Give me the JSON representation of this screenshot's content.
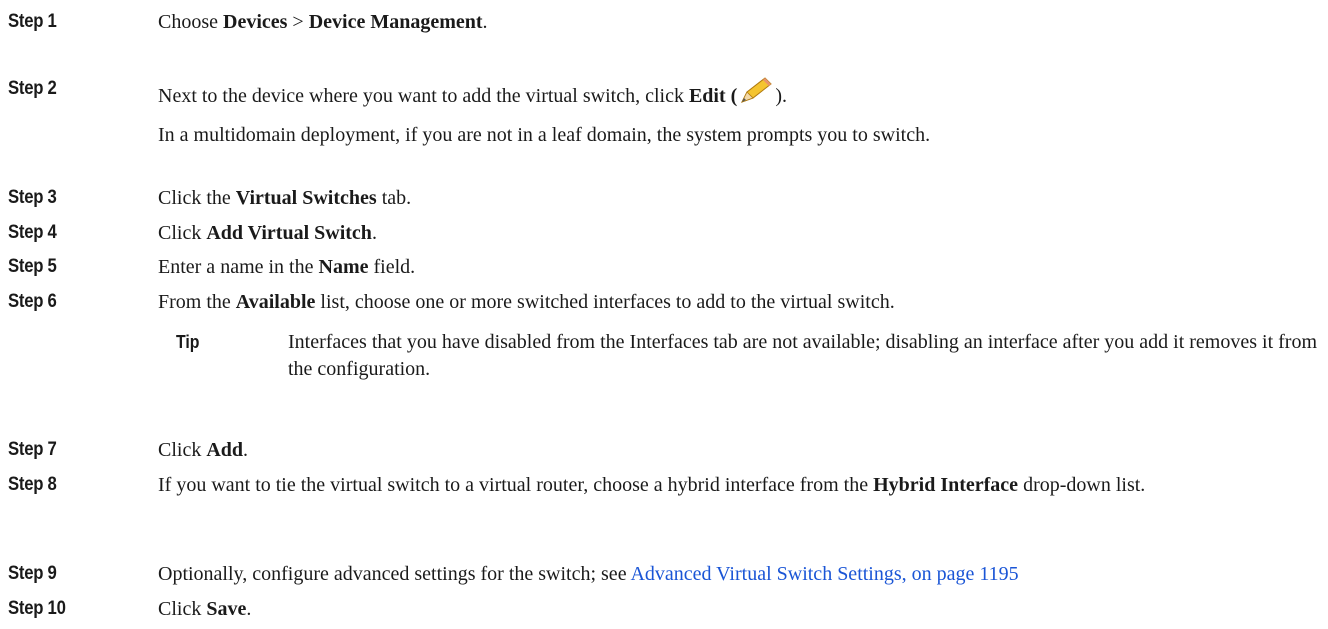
{
  "steps": [
    {
      "label": "Step 1",
      "pre": "Choose ",
      "b1": "Devices",
      "mid": " > ",
      "b2": "Device Management",
      "post": "."
    },
    {
      "label": "Step 2",
      "pre": "Next to the device where you want to add the virtual switch, click ",
      "b1": "Edit",
      "open": " (",
      "icon": "pencil-edit-icon",
      "close": ").",
      "note": "In a multidomain deployment, if you are not in a leaf domain, the system prompts you to switch."
    },
    {
      "label": "Step 3",
      "pre": "Click the ",
      "b1": "Virtual Switches",
      "post": " tab."
    },
    {
      "label": "Step 4",
      "pre": "Click ",
      "b1": "Add Virtual Switch",
      "post": "."
    },
    {
      "label": "Step 5",
      "pre": "Enter a name in the ",
      "b1": "Name",
      "post": " field."
    },
    {
      "label": "Step 6",
      "pre": "From the ",
      "b1": "Available",
      "post": " list, choose one or more switched interfaces to add to the virtual switch."
    },
    {
      "label": "Step 7",
      "pre": "Click ",
      "b1": "Add",
      "post": "."
    },
    {
      "label": "Step 8",
      "pre": "If you want to tie the virtual switch to a virtual router, choose a hybrid interface from the ",
      "b1": "Hybrid Interface",
      "post": " drop-down list."
    },
    {
      "label": "Step 9",
      "pre": "Optionally, configure advanced settings for the switch; see ",
      "link": "Advanced Virtual Switch Settings, on page 1195"
    },
    {
      "label": "Step 10",
      "pre": "Click ",
      "b1": "Save",
      "post": "."
    }
  ],
  "tip": {
    "label": "Tip",
    "text": "Interfaces that you have disabled from the Interfaces tab are not available; disabling an interface after you add it removes it from the configuration."
  },
  "colors": {
    "link": "#1a55d6",
    "text": "#1a1a1a"
  }
}
